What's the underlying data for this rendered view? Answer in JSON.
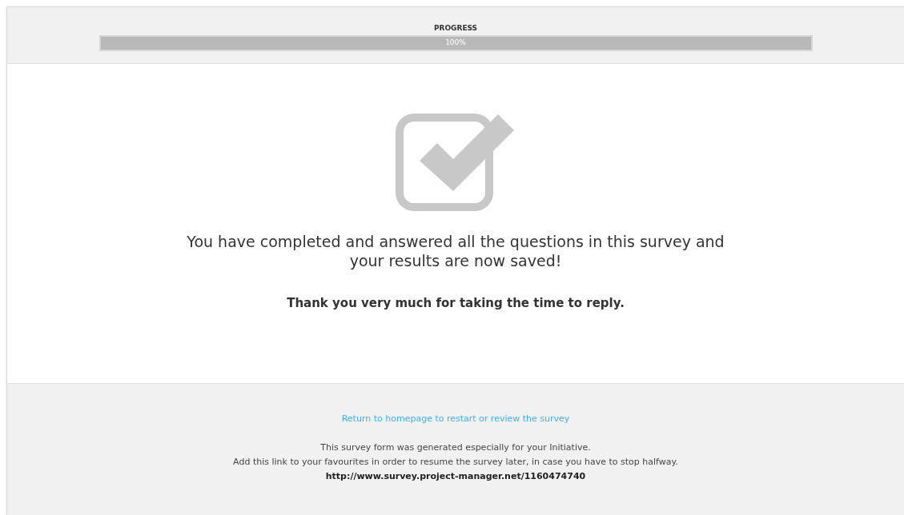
{
  "progress": {
    "label": "PROGRESS",
    "level": 1,
    "reading": "100%"
  },
  "message": {
    "headline": "You have completed and answered all the questions in this survey and your results are now saved!",
    "thanks": "Thank you very much for taking the time to reply."
  },
  "footer": {
    "link": "Return to homepage to restart or review the survey",
    "lines": [
      "This survey form was generated especially for your Initiative.",
      "Add this link to your favourites in order to resume the survey later, in case you have to stop halfway."
    ],
    "url": "http://www.survey.project-manager.net/1160474740"
  }
}
